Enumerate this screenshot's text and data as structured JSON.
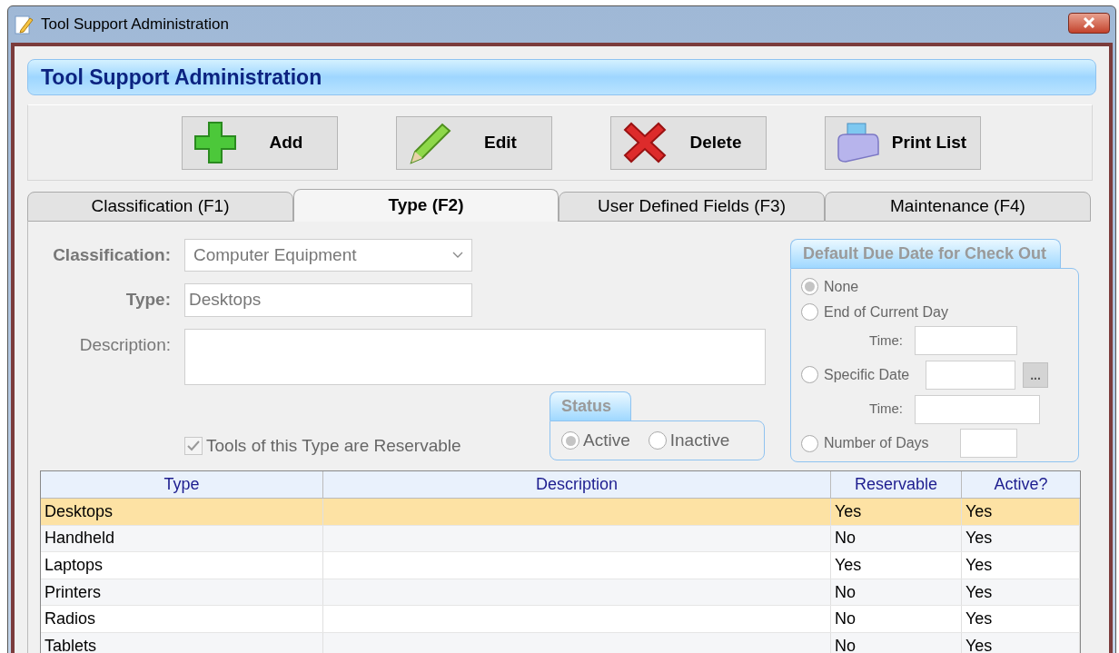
{
  "window": {
    "title": "Tool Support Administration"
  },
  "header": {
    "title": "Tool Support Administration"
  },
  "toolbar": [
    {
      "label": "Add",
      "kind": "add"
    },
    {
      "label": "Edit",
      "kind": "edit"
    },
    {
      "label": "Delete",
      "kind": "delete"
    },
    {
      "label": "Print List",
      "kind": "print"
    }
  ],
  "tabs": [
    {
      "label": "Classification (F1)",
      "selected": false
    },
    {
      "label": "Type (F2)",
      "selected": true
    },
    {
      "label": "User Defined Fields (F3)",
      "selected": false
    },
    {
      "label": "Maintenance (F4)",
      "selected": false
    }
  ],
  "form": {
    "disabled": true,
    "classification": {
      "label": "Classification:",
      "value": "Computer Equipment"
    },
    "type": {
      "label": "Type:",
      "value": "Desktops"
    },
    "description": {
      "label": "Description:"
    },
    "reservable": {
      "label": "Tools of this Type are Reservable",
      "checked": true
    }
  },
  "status": {
    "title": "Status",
    "options": [
      {
        "label": "Active",
        "selected": true
      },
      {
        "label": "Inactive",
        "selected": false
      }
    ]
  },
  "due_date": {
    "title": "Default Due Date for Check Out",
    "options": [
      {
        "label": "None",
        "selected": true
      },
      {
        "label": "End of Current Day",
        "selected": false
      },
      {
        "label": "Specific Date",
        "selected": false
      },
      {
        "label": "Number of Days",
        "selected": false
      }
    ],
    "time_labels": [
      "Time:",
      "Time:"
    ],
    "browse_button": "..."
  },
  "table": {
    "columns": [
      "Type",
      "Description",
      "Reservable",
      "Active?"
    ],
    "rows": [
      {
        "cells": [
          "Desktops",
          "",
          "Yes",
          "Yes"
        ],
        "selected": true
      },
      {
        "cells": [
          "Handheld",
          "",
          "No",
          "Yes"
        ],
        "selected": false
      },
      {
        "cells": [
          "Laptops",
          "",
          "Yes",
          "Yes"
        ],
        "selected": false
      },
      {
        "cells": [
          "Printers",
          "",
          "No",
          "Yes"
        ],
        "selected": false
      },
      {
        "cells": [
          "Radios",
          "",
          "No",
          "Yes"
        ],
        "selected": false
      },
      {
        "cells": [
          "Tablets",
          "",
          "No",
          "Yes"
        ],
        "selected": false
      }
    ]
  }
}
